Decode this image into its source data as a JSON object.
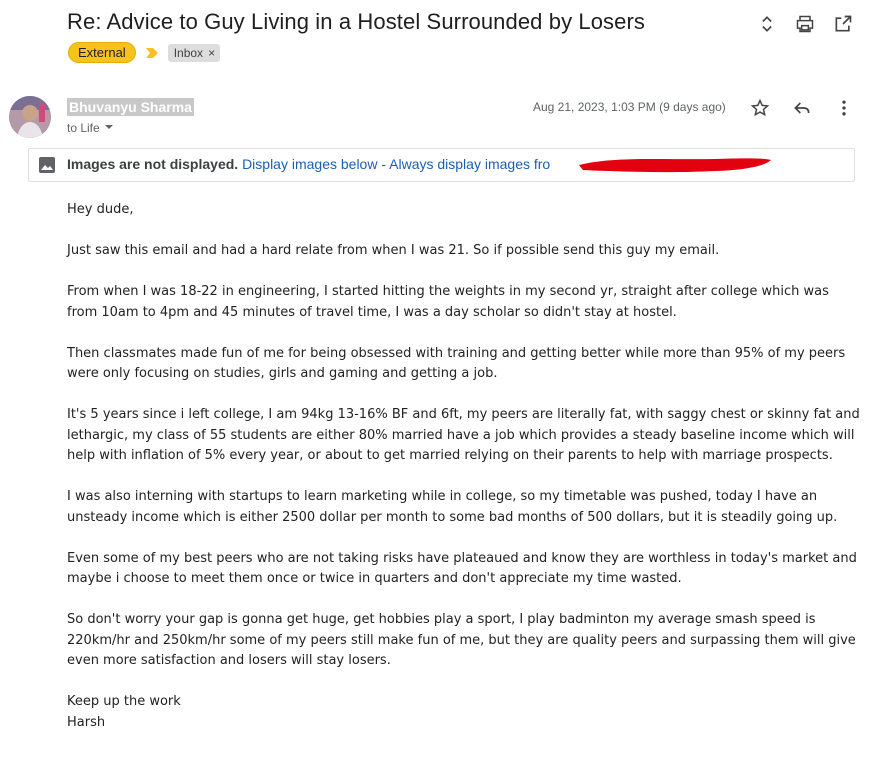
{
  "subject": "Re: Advice to Guy Living in a Hostel Surrounded by Losers",
  "labels": {
    "external": "External",
    "inbox": "Inbox",
    "inbox_remove": "×"
  },
  "icons": {
    "unfold": "unfold-more-icon",
    "print": "print-icon",
    "open_new": "open-in-new-icon",
    "star": "star-icon",
    "reply": "reply-icon",
    "more": "more-vert-icon",
    "image": "image-icon",
    "label_arrow": "label-important-icon"
  },
  "sender": {
    "name": "Bhuvanyu Sharma",
    "to": "to Life",
    "date": "Aug 21, 2023, 1:03 PM (9 days ago)"
  },
  "banner": {
    "bold": "Images are not displayed.",
    "display_below": "Display images below",
    "separator": " - ",
    "always_display": "Always display images fro"
  },
  "body": {
    "p1": "Hey dude,",
    "p2": "Just saw this email and had a hard relate from when I was 21. So if possible send this guy my email.",
    "p3": "From when I was 18-22 in engineering, I started hitting the weights in my second yr, straight after college which was from 10am to 4pm and 45 minutes of travel time, I was a day scholar so didn't stay at hostel.",
    "p4": "Then classmates made fun of me for being obsessed with training and getting better while more than 95% of my peers were only focusing on studies, girls and gaming and getting a job.",
    "p5": "It's 5 years since i left college, I am 94kg 13-16% BF and 6ft, my peers are literally fat, with saggy chest or skinny fat and lethargic, my class of 55 students are either 80% married have a job which provides a steady baseline income which will help with inflation of 5% every year, or about to get married relying on their parents to help with marriage prospects.",
    "p6": "I was also interning with startups to learn marketing while in college, so my timetable was pushed, today I have an unsteady income which is either 2500 dollar per month to some bad months of 500 dollars, but it is steadily going up.",
    "p7": "Even some of my best peers who are not taking risks have plateaued and know they are worthless in today's market and maybe i choose to meet them once or twice in quarters and don't appreciate my time wasted.",
    "p8": "So don't worry your gap is gonna get huge, get hobbies play a sport, I play badminton my average smash speed is 220km/hr and 250km/hr some of my peers still make fun of me, but they are quality peers and surpassing them will give even more satisfaction and losers will stay losers.",
    "sign_off": "Keep up the work",
    "signature": "Harsh"
  },
  "colors": {
    "external_label": "#f8c21c",
    "link": "#1a5fb4",
    "redaction": "#e3000f"
  }
}
